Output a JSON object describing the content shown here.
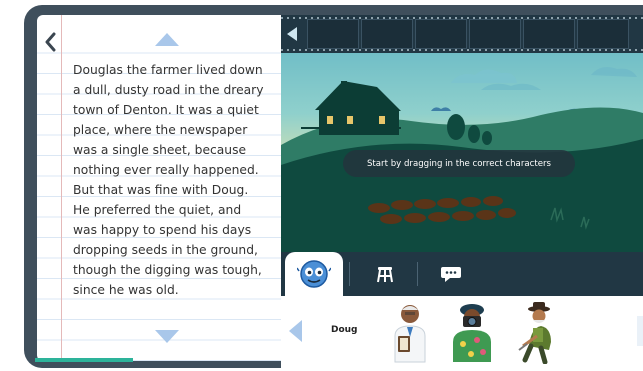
{
  "story_panel": {
    "lines": [
      "Douglas the farmer lived down",
      "a dull, dusty road in the dreary",
      "town of Denton. It was a quiet",
      "place, where the newspaper",
      "was a single sheet, because",
      "nothing ever really happened.",
      "But that was fine with Doug.",
      "He preferred the quiet, and",
      "was happy to spend his days",
      "dropping seeds in the ground,",
      "though the digging was tough,",
      "since he was old."
    ]
  },
  "scene": {
    "instruction": "Start by dragging in the correct characters"
  },
  "toolbar": {
    "tabs": [
      {
        "icon": "character-face-icon",
        "active": true
      },
      {
        "icon": "stool-icon",
        "active": false
      },
      {
        "icon": "speech-bubble-icon",
        "active": false
      }
    ]
  },
  "tray": {
    "label": "Doug",
    "characters": [
      {
        "icon": "doctor-character-icon"
      },
      {
        "icon": "photographer-character-icon"
      },
      {
        "icon": "farmer-character-icon"
      }
    ]
  },
  "colors": {
    "frame": "#3f4f5c",
    "filmstrip": "#213744",
    "arrows": "#a9c7ea",
    "progress": "#2db39a"
  }
}
